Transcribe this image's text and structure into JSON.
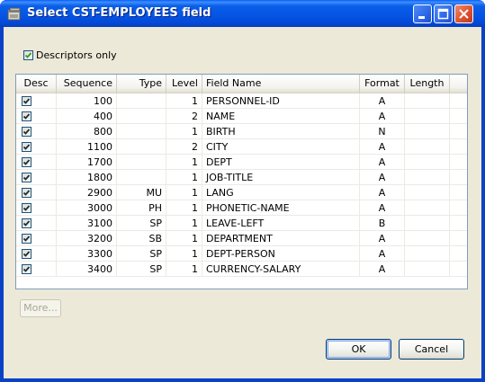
{
  "window": {
    "title": "Select CST-EMPLOYEES field"
  },
  "options": {
    "descriptors_only_label": "Descriptors only",
    "descriptors_only_checked": true
  },
  "table": {
    "headers": {
      "desc": "Desc",
      "sequence": "Sequence",
      "type": "Type",
      "level": "Level",
      "field_name": "Field Name",
      "format": "Format",
      "length": "Length"
    },
    "rows": [
      {
        "desc": true,
        "sequence": "100",
        "type": "",
        "level": "1",
        "field_name": "PERSONNEL-ID",
        "format": "A",
        "length": ""
      },
      {
        "desc": true,
        "sequence": "400",
        "type": "",
        "level": "2",
        "field_name": "NAME",
        "format": "A",
        "length": ""
      },
      {
        "desc": true,
        "sequence": "800",
        "type": "",
        "level": "1",
        "field_name": "BIRTH",
        "format": "N",
        "length": ""
      },
      {
        "desc": true,
        "sequence": "1100",
        "type": "",
        "level": "2",
        "field_name": "CITY",
        "format": "A",
        "length": ""
      },
      {
        "desc": true,
        "sequence": "1700",
        "type": "",
        "level": "1",
        "field_name": "DEPT",
        "format": "A",
        "length": ""
      },
      {
        "desc": true,
        "sequence": "1800",
        "type": "",
        "level": "1",
        "field_name": "JOB-TITLE",
        "format": "A",
        "length": ""
      },
      {
        "desc": true,
        "sequence": "2900",
        "type": "MU",
        "level": "1",
        "field_name": "LANG",
        "format": "A",
        "length": ""
      },
      {
        "desc": true,
        "sequence": "3000",
        "type": "PH",
        "level": "1",
        "field_name": "PHONETIC-NAME",
        "format": "A",
        "length": ""
      },
      {
        "desc": true,
        "sequence": "3100",
        "type": "SP",
        "level": "1",
        "field_name": "LEAVE-LEFT",
        "format": "B",
        "length": ""
      },
      {
        "desc": true,
        "sequence": "3200",
        "type": "SB",
        "level": "1",
        "field_name": "DEPARTMENT",
        "format": "A",
        "length": ""
      },
      {
        "desc": true,
        "sequence": "3300",
        "type": "SP",
        "level": "1",
        "field_name": "DEPT-PERSON",
        "format": "A",
        "length": ""
      },
      {
        "desc": true,
        "sequence": "3400",
        "type": "SP",
        "level": "1",
        "field_name": "CURRENCY-SALARY",
        "format": "A",
        "length": ""
      }
    ]
  },
  "buttons": {
    "more": "More...",
    "ok": "OK",
    "cancel": "Cancel"
  },
  "colors": {
    "titlebar": "#0554e4",
    "dialog_background": "#ece9d8",
    "close_button": "#e0522f",
    "check_mark": "#21a121"
  },
  "icons": {
    "app": "database-window-icon",
    "minimize": "minimize-icon",
    "maximize": "maximize-icon",
    "close": "close-icon",
    "check": "check-icon"
  }
}
